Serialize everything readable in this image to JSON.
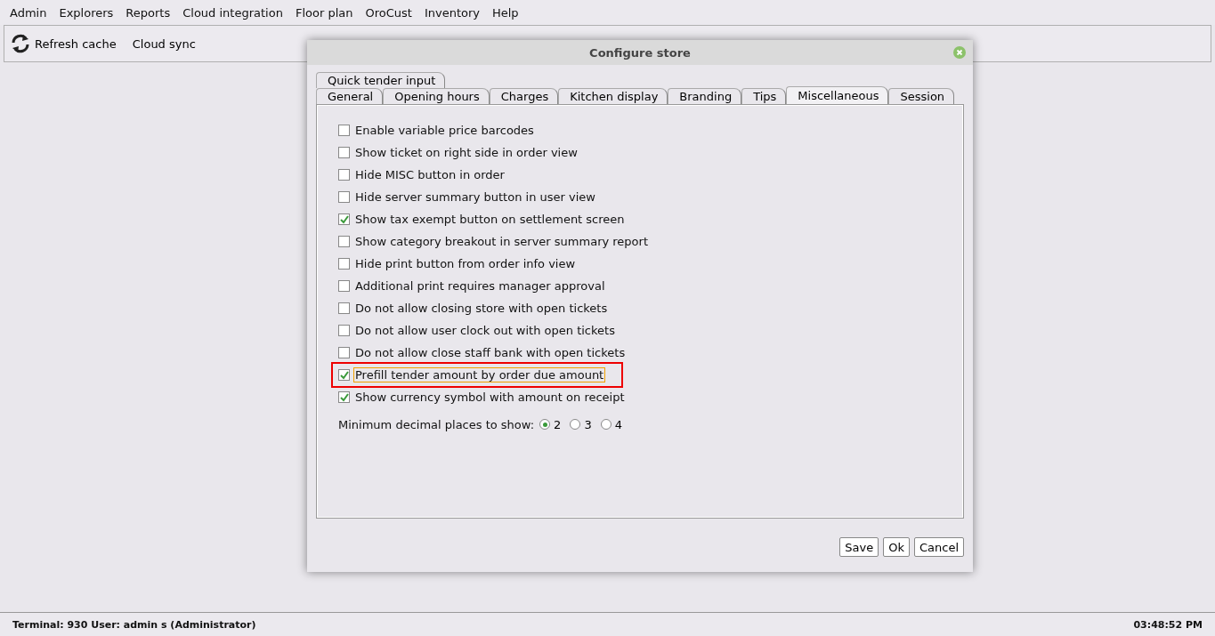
{
  "menu_bar": [
    "Admin",
    "Explorers",
    "Reports",
    "Cloud integration",
    "Floor plan",
    "OroCust",
    "Inventory",
    "Help"
  ],
  "toolbar": [
    {
      "label": "Refresh cache",
      "kind": "refresh"
    },
    {
      "label": "Cloud sync",
      "kind": "plain"
    }
  ],
  "dialog": {
    "title": "Configure store",
    "tab_rows": [
      [
        {
          "label": "Quick tender input",
          "selected": false
        }
      ],
      [
        {
          "label": "General",
          "selected": false
        },
        {
          "label": "Opening hours",
          "selected": false
        },
        {
          "label": "Charges",
          "selected": false
        },
        {
          "label": "Kitchen display",
          "selected": false
        },
        {
          "label": "Branding",
          "selected": false
        },
        {
          "label": "Tips",
          "selected": false
        },
        {
          "label": "Miscellaneous",
          "selected": true
        },
        {
          "label": "Session",
          "selected": false
        }
      ]
    ],
    "options": [
      {
        "label": "Enable variable price barcodes",
        "checked": false,
        "focused": false,
        "highlighted": false
      },
      {
        "label": "Show ticket on right side in order view",
        "checked": false,
        "focused": false,
        "highlighted": false
      },
      {
        "label": "Hide MISC button in order",
        "checked": false,
        "focused": false,
        "highlighted": false
      },
      {
        "label": "Hide server summary button in user view",
        "checked": false,
        "focused": false,
        "highlighted": false
      },
      {
        "label": "Show tax exempt button on settlement screen",
        "checked": true,
        "focused": false,
        "highlighted": false
      },
      {
        "label": "Show category breakout in server summary report",
        "checked": false,
        "focused": false,
        "highlighted": false
      },
      {
        "label": "Hide print button from order info view",
        "checked": false,
        "focused": false,
        "highlighted": false
      },
      {
        "label": "Additional print requires manager approval",
        "checked": false,
        "focused": false,
        "highlighted": false
      },
      {
        "label": "Do not allow closing store with open tickets",
        "checked": false,
        "focused": false,
        "highlighted": false
      },
      {
        "label": "Do not allow user clock out with open tickets",
        "checked": false,
        "focused": false,
        "highlighted": false
      },
      {
        "label": "Do not allow close staff bank with open tickets",
        "checked": false,
        "focused": false,
        "highlighted": false
      },
      {
        "label": "Prefill tender amount by order due amount",
        "checked": true,
        "focused": true,
        "highlighted": true
      },
      {
        "label": "Show currency symbol with amount on receipt",
        "checked": true,
        "focused": false,
        "highlighted": false
      }
    ],
    "decimal_places": {
      "label": "Minimum decimal places to show:",
      "options": [
        {
          "label": "2",
          "selected": true
        },
        {
          "label": "3",
          "selected": false
        },
        {
          "label": "4",
          "selected": false
        }
      ]
    },
    "buttons": [
      "Save",
      "Ok",
      "Cancel"
    ]
  },
  "status_bar": {
    "left": "Terminal: 930 User: admin s (Administrator)",
    "right": "03:48:52 PM"
  }
}
